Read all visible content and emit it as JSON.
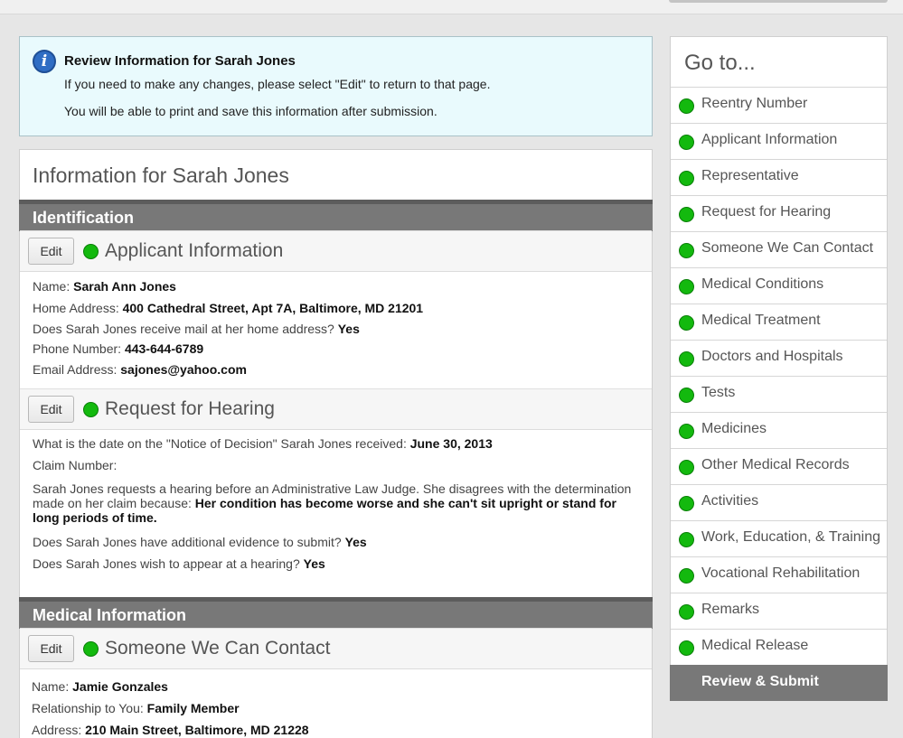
{
  "info": {
    "title": "Review Information for Sarah Jones",
    "line1": "If you need to make any changes, please select \"Edit\" to return to that page.",
    "line2": "You will be able to print and save this information after submission.",
    "icon": "info-icon"
  },
  "main": {
    "title": "Information for Sarah Jones",
    "identification_header": "Identification",
    "medical_header": "Medical Information",
    "edit_label": "Edit",
    "applicant": {
      "title": "Applicant Information",
      "name_label": "Name:",
      "name": "Sarah Ann Jones",
      "address_label": "Home Address:",
      "address": "400 Cathedral Street, Apt 7A, Baltimore, MD 21201",
      "mail_label": "Does Sarah Jones receive mail at her home address?",
      "mail": "Yes",
      "phone_label": "Phone Number:",
      "phone": "443-644-6789",
      "email_label": "Email Address:",
      "email": "sajones@yahoo.com"
    },
    "hearing": {
      "title": "Request for Hearing",
      "notice_label": "What is the date on the \"Notice of Decision\" Sarah Jones received:",
      "notice": "June 30, 2013",
      "claim_label": "Claim Number:",
      "reason_label": "Sarah Jones requests a hearing before an Administrative Law Judge. She disagrees with the determination made on her claim because:",
      "reason": "Her condition has become worse and she can't sit upright or stand for long periods of time.",
      "evidence_label": "Does Sarah Jones have additional evidence to submit?",
      "evidence": "Yes",
      "appear_label": "Does Sarah Jones wish to appear at a hearing?",
      "appear": "Yes"
    },
    "contact": {
      "title": "Someone We Can Contact",
      "name_label": "Name:",
      "name": "Jamie Gonzales",
      "relationship_label": "Relationship to You:",
      "relationship": "Family Member",
      "address_label": "Address:",
      "address": "210 Main Street, Baltimore, MD 21228"
    }
  },
  "sidebar": {
    "title": "Go to...",
    "items": [
      {
        "label": "Reentry Number"
      },
      {
        "label": "Applicant Information"
      },
      {
        "label": "Representative"
      },
      {
        "label": "Request for Hearing"
      },
      {
        "label": "Someone We Can Contact"
      },
      {
        "label": "Medical Conditions"
      },
      {
        "label": "Medical Treatment"
      },
      {
        "label": "Doctors and Hospitals"
      },
      {
        "label": "Tests"
      },
      {
        "label": "Medicines"
      },
      {
        "label": "Other Medical Records"
      },
      {
        "label": "Activities"
      },
      {
        "label": "Work, Education, & Training"
      },
      {
        "label": "Vocational Rehabilitation"
      },
      {
        "label": "Remarks"
      },
      {
        "label": "Medical Release"
      }
    ],
    "submit_label": "Review & Submit",
    "status_color": "#13b90e"
  }
}
